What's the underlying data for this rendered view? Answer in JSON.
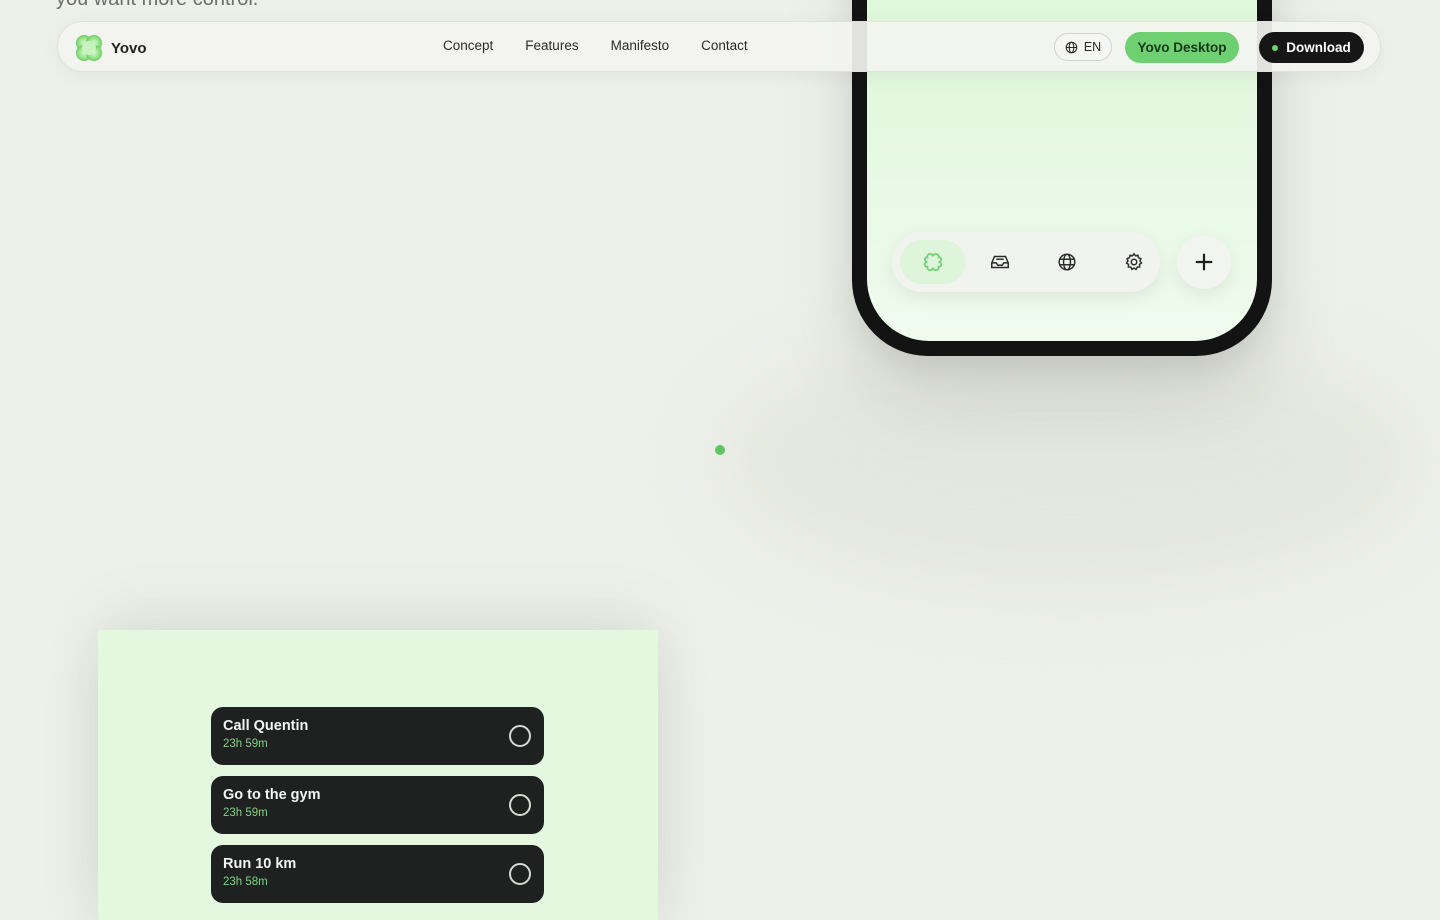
{
  "hero": {
    "partial_text": "you want more control."
  },
  "nav": {
    "brand": "Yovo",
    "links": [
      "Concept",
      "Features",
      "Manifesto",
      "Contact"
    ],
    "language": "EN",
    "desktop_label": "Yovo Desktop",
    "download_label": "Download"
  },
  "phone": {
    "tabs": [
      "clover-icon",
      "inbox-icon",
      "globe-icon",
      "gear-icon"
    ],
    "add_icon": "plus-icon"
  },
  "tasks": [
    {
      "title": "Call Quentin",
      "time": "23h 59m"
    },
    {
      "title": "Go to the gym",
      "time": "23h 59m"
    },
    {
      "title": "Run 10 km",
      "time": "23h 58m"
    }
  ],
  "colors": {
    "accent": "#6fd072",
    "dark": "#151615",
    "background": "#eef0ea",
    "screen": "#e3f8de"
  }
}
